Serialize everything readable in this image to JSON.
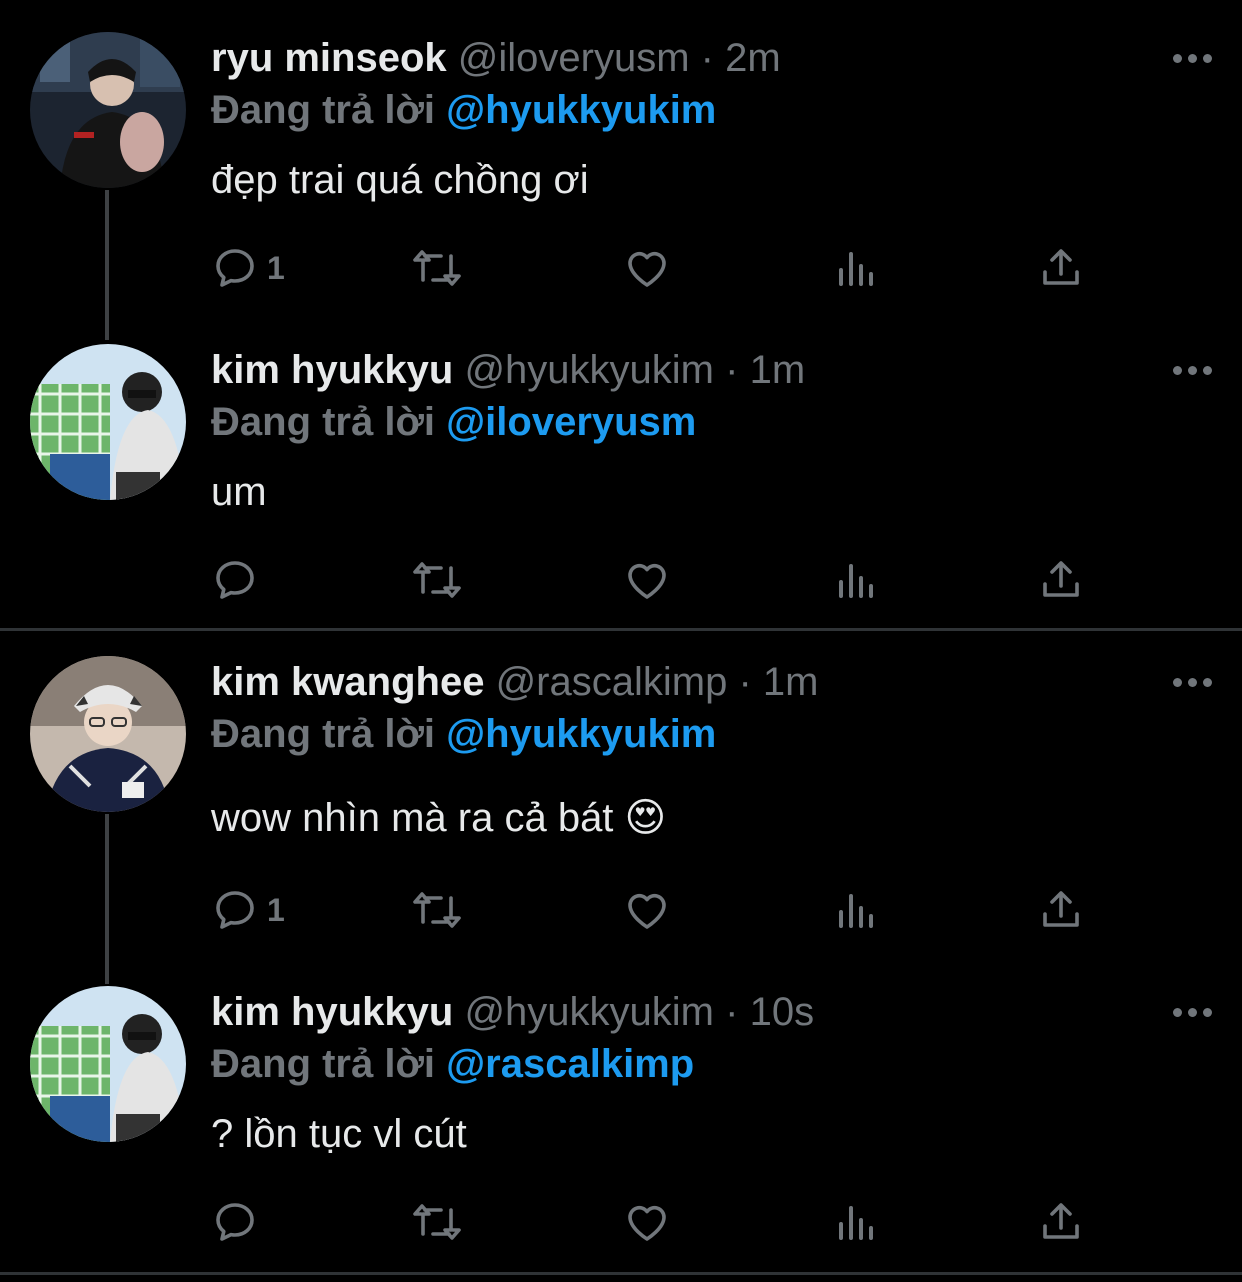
{
  "colors": {
    "background": "#000000",
    "muted": "#71767b",
    "mention": "#1d9bf0",
    "text": "#e7e9ea"
  },
  "tweets": [
    {
      "name": "ryu minseok",
      "handle": "@iloveryusm",
      "dot": "·",
      "time": "2m",
      "replying_label": "Đang trả lời",
      "replying_to": "@hyukkyukim",
      "text": "đẹp trai quá chồng ơi",
      "reply_count": "1"
    },
    {
      "name": "kim hyukkyu",
      "handle": "@hyukkyukim",
      "dot": "·",
      "time": "1m",
      "replying_label": "Đang trả lời",
      "replying_to": "@iloveryusm",
      "text": "um",
      "reply_count": ""
    },
    {
      "name": "kim kwanghee",
      "handle": "@rascalkimp",
      "dot": "·",
      "time": "1m",
      "replying_label": "Đang trả lời",
      "replying_to": "@hyukkyukim",
      "text": "wow nhìn mà ra cả bát",
      "emoji": "😍",
      "reply_count": "1"
    },
    {
      "name": "kim hyukkyu",
      "handle": "@hyukkyukim",
      "dot": "·",
      "time": "10s",
      "replying_label": "Đang trả lời",
      "replying_to": "@rascalkimp",
      "text": "? lồn tục vl cút",
      "reply_count": ""
    }
  ],
  "icons": [
    "reply-icon",
    "retweet-icon",
    "like-icon",
    "analytics-icon",
    "share-icon",
    "more-icon"
  ]
}
